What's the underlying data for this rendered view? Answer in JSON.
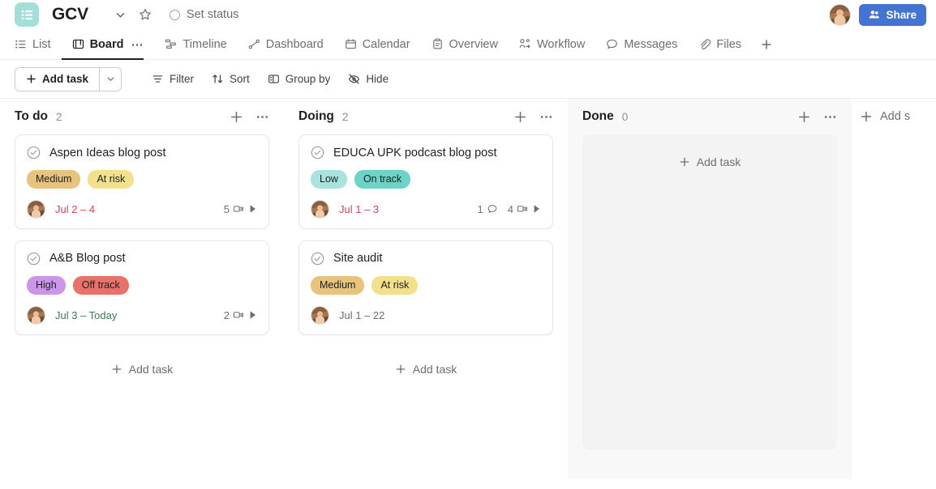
{
  "header": {
    "app_icon": "list-icon",
    "project_title": "GCV",
    "chevron_icon": "chevron-down-icon",
    "star_icon": "star-icon",
    "set_status_label": "Set status",
    "status_icon": "status-circle-icon",
    "avatar_name": "user-avatar",
    "share_label": "Share",
    "share_icon": "people-icon",
    "share_color": "#4573d2"
  },
  "tabs": [
    {
      "label": "List",
      "icon": "list-view-icon",
      "active": false
    },
    {
      "label": "Board",
      "icon": "board-view-icon",
      "active": true,
      "overflow": "⋯"
    },
    {
      "label": "Timeline",
      "icon": "timeline-icon",
      "active": false
    },
    {
      "label": "Dashboard",
      "icon": "dashboard-icon",
      "active": false
    },
    {
      "label": "Calendar",
      "icon": "calendar-icon",
      "active": false
    },
    {
      "label": "Overview",
      "icon": "overview-icon",
      "active": false
    },
    {
      "label": "Workflow",
      "icon": "workflow-icon",
      "active": false
    },
    {
      "label": "Messages",
      "icon": "messages-icon",
      "active": false
    },
    {
      "label": "Files",
      "icon": "files-icon",
      "active": false
    }
  ],
  "tab_add_icon": "plus-icon",
  "toolbar": {
    "add_task_label": "Add task",
    "add_task_icon": "plus-icon",
    "add_task_caret_icon": "chevron-down-icon",
    "buttons": [
      {
        "label": "Filter",
        "icon": "filter-icon"
      },
      {
        "label": "Sort",
        "icon": "sort-icon"
      },
      {
        "label": "Group by",
        "icon": "group-by-icon"
      },
      {
        "label": "Hide",
        "icon": "hide-eye-icon"
      }
    ]
  },
  "board": {
    "add_task_label": "Add task",
    "add_task_icon": "plus-icon",
    "add_section_label": "Add s",
    "add_section_icon": "plus-icon",
    "column_add_icon": "plus-icon",
    "column_menu_icon": "ellipsis-icon",
    "columns": [
      {
        "name": "To do",
        "count": "2",
        "empty": false,
        "cards": [
          {
            "title": "Aspen Ideas blog post",
            "check_icon": "check-circle-icon",
            "chips": [
              {
                "label": "Medium",
                "color": "#e8c37e"
              },
              {
                "label": "At risk",
                "color": "#f2e08c"
              }
            ],
            "date": "Jul 2 – 4",
            "date_color": "#d1425a",
            "comments": null,
            "subtasks": "5",
            "subtask_icon": "subtask-icon",
            "expand_icon": "expand-triangle-icon"
          },
          {
            "title": "A&B Blog post",
            "check_icon": "check-circle-icon",
            "chips": [
              {
                "label": "High",
                "color": "#cd95ea"
              },
              {
                "label": "Off track",
                "color": "#e8726a"
              }
            ],
            "date": "Jul 3 – Today",
            "date_color": "#3c7a53",
            "comments": null,
            "subtasks": "2",
            "subtask_icon": "subtask-icon",
            "expand_icon": "expand-triangle-icon"
          }
        ]
      },
      {
        "name": "Doing",
        "count": "2",
        "empty": false,
        "cards": [
          {
            "title": "EDUCA UPK podcast blog post",
            "check_icon": "check-circle-icon",
            "chips": [
              {
                "label": "Low",
                "color": "#a9e3dd"
              },
              {
                "label": "On track",
                "color": "#6ed3c7"
              }
            ],
            "date": "Jul 1 – 3",
            "date_color": "#d1425a",
            "comments": "1",
            "comment_icon": "comment-icon",
            "subtasks": "4",
            "subtask_icon": "subtask-icon",
            "expand_icon": "expand-triangle-icon"
          },
          {
            "title": "Site audit",
            "check_icon": "check-circle-icon",
            "chips": [
              {
                "label": "Medium",
                "color": "#e8c37e"
              },
              {
                "label": "At risk",
                "color": "#f2e08c"
              }
            ],
            "date": "Jul 1 – 22",
            "date_color": "#6d6e6f",
            "comments": null,
            "subtasks": null
          }
        ]
      },
      {
        "name": "Done",
        "count": "0",
        "empty": true,
        "cards": []
      }
    ]
  }
}
